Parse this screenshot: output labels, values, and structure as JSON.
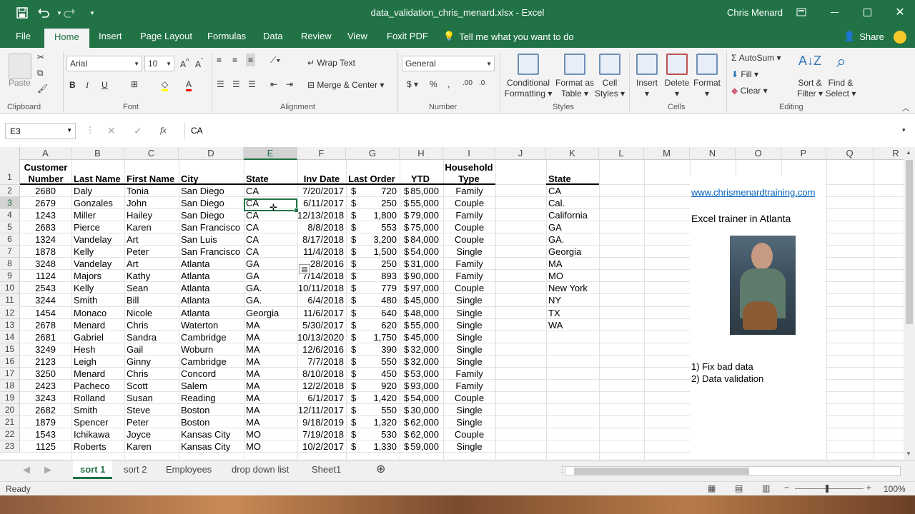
{
  "app": {
    "doc_title": "data_validation_chris_menard.xlsx  -  Excel",
    "user": "Chris Menard"
  },
  "tabs": [
    "File",
    "Home",
    "Insert",
    "Page Layout",
    "Formulas",
    "Data",
    "Review",
    "View",
    "Foxit PDF"
  ],
  "tell_me": "Tell me what you want to do",
  "share": "Share",
  "ribbon": {
    "clipboard": {
      "paste": "Paste",
      "label": "Clipboard"
    },
    "font": {
      "name": "Arial",
      "size": "10",
      "label": "Font"
    },
    "alignment": {
      "wrap": "Wrap Text",
      "merge": "Merge & Center",
      "label": "Alignment"
    },
    "number": {
      "format": "General",
      "label": "Number"
    },
    "styles": {
      "cond1": "Conditional",
      "cond2": "Formatting",
      "fmt1": "Format as",
      "fmt2": "Table",
      "cell1": "Cell",
      "cell2": "Styles",
      "label": "Styles"
    },
    "cells": {
      "insert": "Insert",
      "delete": "Delete",
      "format": "Format",
      "label": "Cells"
    },
    "editing": {
      "autosum": "AutoSum",
      "fill": "Fill",
      "clear": "Clear",
      "sort1": "Sort &",
      "sort2": "Filter",
      "find1": "Find &",
      "find2": "Select",
      "label": "Editing"
    }
  },
  "formula_bar": {
    "name_box": "E3",
    "content": "CA"
  },
  "columns": [
    "A",
    "B",
    "C",
    "D",
    "E",
    "F",
    "G",
    "H",
    "I",
    "J",
    "K",
    "L",
    "M",
    "N",
    "O",
    "P",
    "Q",
    "R"
  ],
  "header_row": {
    "a1": "Customer",
    "a2": "Number",
    "b": "Last Name",
    "c": "First Name",
    "d": "City",
    "e": "State",
    "f": "Inv Date",
    "g": "Last Order",
    "h": "YTD",
    "i1": "Household",
    "i2": "Type",
    "k": "State"
  },
  "rows": [
    {
      "n": "2",
      "a": "2680",
      "b": "Daly",
      "c": "Tonia",
      "d": "San Diego",
      "e": "CA",
      "f": "7/20/2017",
      "g": "720",
      "h": "85,000",
      "i": "Family",
      "k": "CA"
    },
    {
      "n": "3",
      "a": "2679",
      "b": "Gonzales",
      "c": "John",
      "d": "San Diego",
      "e": "CA",
      "f": "6/11/2017",
      "g": "250",
      "h": "55,000",
      "i": "Couple",
      "k": "Cal."
    },
    {
      "n": "4",
      "a": "1243",
      "b": "Miller",
      "c": "Hailey",
      "d": "San Diego",
      "e": "CA",
      "f": "12/13/2018",
      "g": "1,800",
      "h": "79,000",
      "i": "Family",
      "k": "California"
    },
    {
      "n": "5",
      "a": "2683",
      "b": "Pierce",
      "c": "Karen",
      "d": "San Francisco",
      "e": "CA",
      "f": "8/8/2018",
      "g": "553",
      "h": "75,000",
      "i": "Couple",
      "k": "GA"
    },
    {
      "n": "6",
      "a": "1324",
      "b": "Vandelay",
      "c": "Art",
      "d": "San Luis",
      "e": "CA",
      "f": "8/17/2018",
      "g": "3,200",
      "h": "84,000",
      "i": "Couple",
      "k": "GA."
    },
    {
      "n": "7",
      "a": "1878",
      "b": "Kelly",
      "c": "Peter",
      "d": "San Francisco",
      "e": "CA",
      "f": "11/4/2018",
      "g": "1,500",
      "h": "54,000",
      "i": "Single",
      "k": "Georgia"
    },
    {
      "n": "8",
      "a": "3248",
      "b": "Vandelay",
      "c": "Art",
      "d": "Atlanta",
      "e": "GA",
      "f": "28/2016",
      "g": "250",
      "h": "31,000",
      "i": "Family",
      "k": "MA"
    },
    {
      "n": "9",
      "a": "1124",
      "b": "Majors",
      "c": "Kathy",
      "d": "Atlanta",
      "e": "GA",
      "f": "7/14/2018",
      "g": "893",
      "h": "90,000",
      "i": "Family",
      "k": "MO"
    },
    {
      "n": "10",
      "a": "2543",
      "b": "Kelly",
      "c": "Sean",
      "d": "Atlanta",
      "e": "GA.",
      "f": "10/11/2018",
      "g": "779",
      "h": "97,000",
      "i": "Couple",
      "k": "New York"
    },
    {
      "n": "11",
      "a": "3244",
      "b": "Smith",
      "c": "Bill",
      "d": "Atlanta",
      "e": "GA.",
      "f": "6/4/2018",
      "g": "480",
      "h": "45,000",
      "i": "Single",
      "k": "NY"
    },
    {
      "n": "12",
      "a": "1454",
      "b": "Monaco",
      "c": "Nicole",
      "d": "Atlanta",
      "e": "Georgia",
      "f": "11/6/2017",
      "g": "640",
      "h": "48,000",
      "i": "Single",
      "k": "TX"
    },
    {
      "n": "13",
      "a": "2678",
      "b": "Menard",
      "c": "Chris",
      "d": "Waterton",
      "e": "MA",
      "f": "5/30/2017",
      "g": "620",
      "h": "55,000",
      "i": "Single",
      "k": "WA"
    },
    {
      "n": "14",
      "a": "2681",
      "b": "Gabriel",
      "c": "Sandra",
      "d": "Cambridge",
      "e": "MA",
      "f": "10/13/2020",
      "g": "1,750",
      "h": "45,000",
      "i": "Single",
      "k": ""
    },
    {
      "n": "15",
      "a": "3249",
      "b": "Hesh",
      "c": "Gail",
      "d": "Woburn",
      "e": "MA",
      "f": "12/6/2016",
      "g": "390",
      "h": "32,000",
      "i": "Single",
      "k": ""
    },
    {
      "n": "16",
      "a": "2123",
      "b": "Leigh",
      "c": "Ginny",
      "d": "Cambridge",
      "e": "MA",
      "f": "7/7/2018",
      "g": "550",
      "h": "32,000",
      "i": "Single",
      "k": ""
    },
    {
      "n": "17",
      "a": "3250",
      "b": "Menard",
      "c": "Chris",
      "d": "Concord",
      "e": "MA",
      "f": "8/10/2018",
      "g": "450",
      "h": "53,000",
      "i": "Family",
      "k": ""
    },
    {
      "n": "18",
      "a": "2423",
      "b": "Pacheco",
      "c": "Scott",
      "d": "Salem",
      "e": "MA",
      "f": "12/2/2018",
      "g": "920",
      "h": "93,000",
      "i": "Family",
      "k": ""
    },
    {
      "n": "19",
      "a": "3243",
      "b": "Rolland",
      "c": "Susan",
      "d": "Reading",
      "e": "MA",
      "f": "6/1/2017",
      "g": "1,420",
      "h": "54,000",
      "i": "Couple",
      "k": ""
    },
    {
      "n": "20",
      "a": "2682",
      "b": "Smith",
      "c": "Steve",
      "d": "Boston",
      "e": "MA",
      "f": "12/11/2017",
      "g": "550",
      "h": "30,000",
      "i": "Single",
      "k": ""
    },
    {
      "n": "21",
      "a": "1879",
      "b": "Spencer",
      "c": "Peter",
      "d": "Boston",
      "e": "MA",
      "f": "9/18/2019",
      "g": "1,320",
      "h": "62,000",
      "i": "Single",
      "k": ""
    },
    {
      "n": "22",
      "a": "1543",
      "b": "Ichikawa",
      "c": "Joyce",
      "d": "Kansas City",
      "e": "MO",
      "f": "7/19/2018",
      "g": "530",
      "h": "62,000",
      "i": "Couple",
      "k": ""
    },
    {
      "n": "23",
      "a": "1125",
      "b": "Roberts",
      "c": "Karen",
      "d": "Kansas City",
      "e": "MO",
      "f": "10/2/2017",
      "g": "1,330",
      "h": "59,000",
      "i": "Single",
      "k": ""
    }
  ],
  "currency_symbol": "$",
  "side_notes": {
    "url": "www.chrismenardtraining.com",
    "tagline": "Excel trainer in Atlanta",
    "note1": "1) Fix bad data",
    "note2": "2) Data validation"
  },
  "sheets": [
    "sort 1",
    "sort 2",
    "Employees",
    "drop down list",
    "Sheet1"
  ],
  "active_sheet": "sort 1",
  "status": {
    "text": "Ready",
    "zoom": "100%"
  },
  "colors": {
    "accent": "#217346",
    "link": "#0563c1"
  }
}
